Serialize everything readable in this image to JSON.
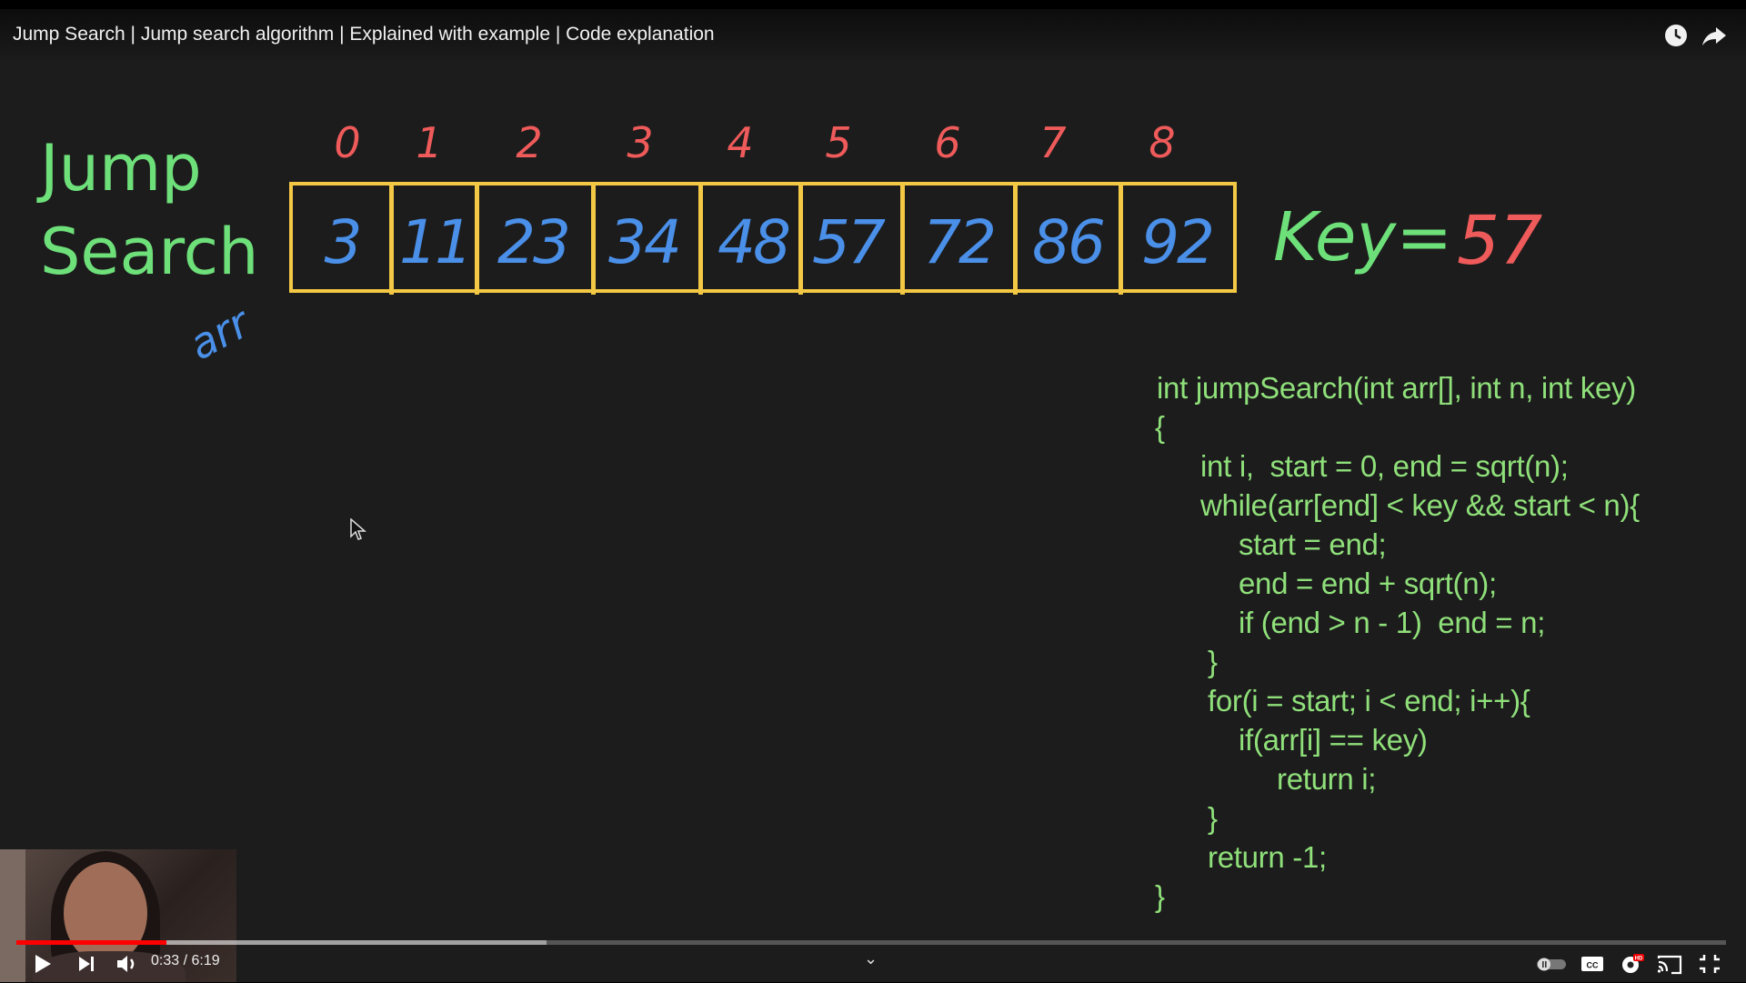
{
  "video": {
    "title": "Jump Search | Jump search algorithm | Explained with example | Code explanation"
  },
  "board": {
    "title_line1": "Jump",
    "title_line2": "Search",
    "array_name": "arr",
    "indices": [
      "0",
      "1",
      "2",
      "3",
      "4",
      "5",
      "6",
      "7",
      "8"
    ],
    "values": [
      "3",
      "11",
      "23",
      "34",
      "48",
      "57",
      "72",
      "86",
      "92"
    ],
    "key_label": "Key",
    "key_eq": "=",
    "key_value": "57",
    "colors": {
      "title": "#6ee07a",
      "index": "#ef5a5a",
      "value": "#4a8fe8",
      "box": "#f2c844",
      "code": "#8fe07a"
    }
  },
  "code": {
    "lines": [
      "int jumpSearch(int arr[], int n, int key)",
      "{",
      "int i,  start = 0, end = sqrt(n);",
      "while(arr[end] < key && start < n){",
      "start = end;",
      "end = end + sqrt(n);",
      "if (end > n - 1)  end = n;",
      "}",
      "for(i = start; i < end; i++){",
      "if(arr[i] == key)",
      "return i;",
      "}",
      "return -1;",
      "}"
    ]
  },
  "player": {
    "time_display": "0:33 / 6:19",
    "progress_fraction": 0.088,
    "buffered_fraction": 0.31,
    "icons": {
      "watch_later": "clock-icon",
      "share": "share-icon",
      "play": "play-icon",
      "next": "next-icon",
      "volume": "volume-icon",
      "autoplay": "autoplay-toggle-icon",
      "captions": "captions-icon",
      "settings": "gear-icon",
      "cast": "cast-icon",
      "fullscreen": "exit-fullscreen-icon",
      "expand": "chevron-down-icon"
    }
  }
}
